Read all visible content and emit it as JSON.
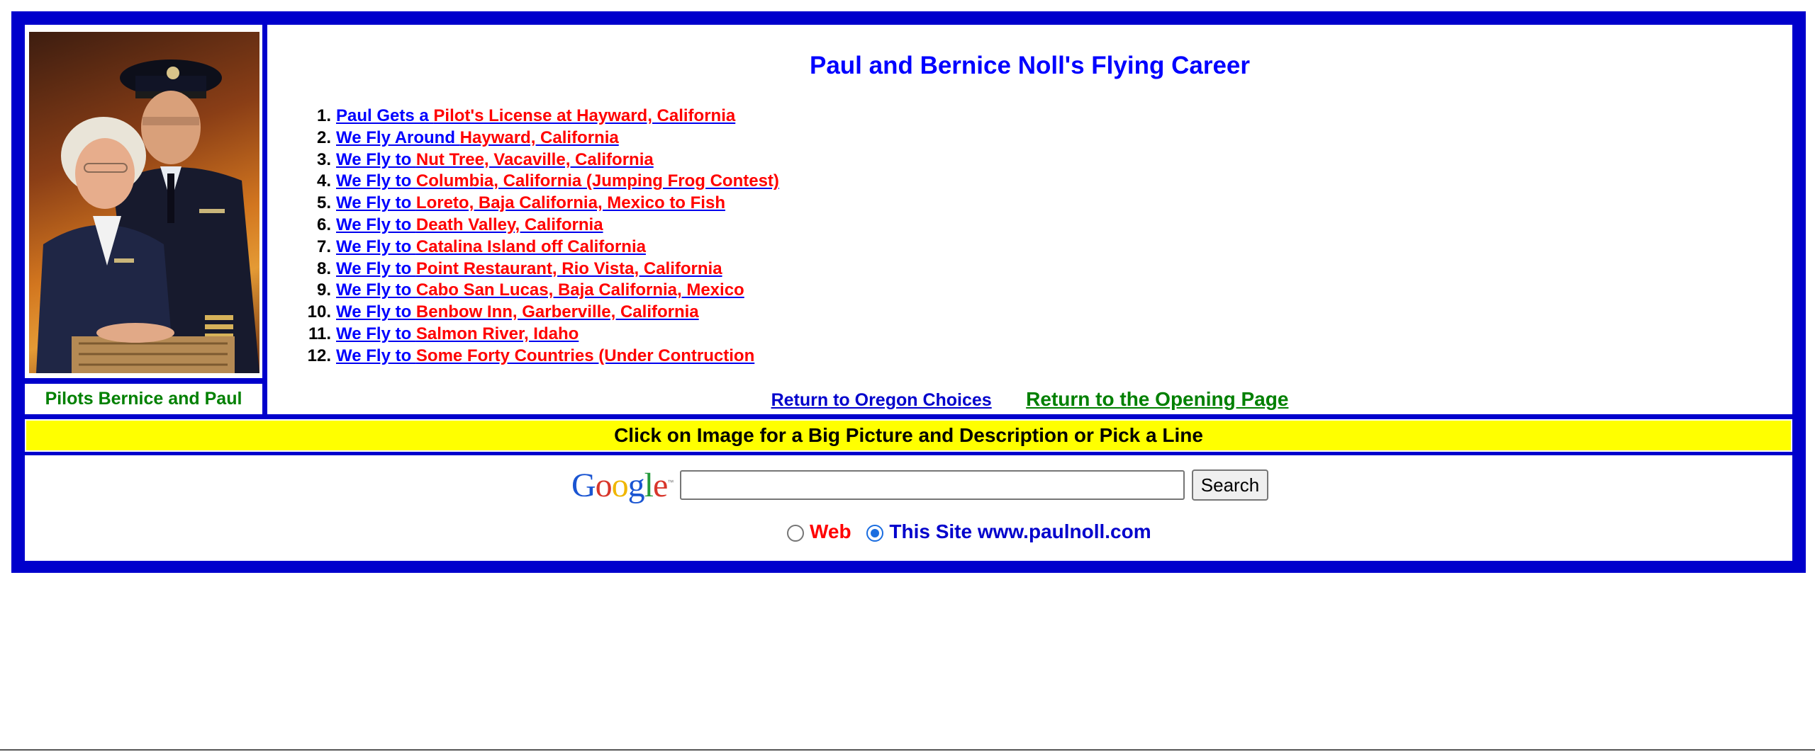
{
  "photo": {
    "caption": "Pilots Bernice and Paul",
    "alt": "Bernice and Paul in pilot uniforms"
  },
  "title": "Paul and Bernice Noll's Flying Career",
  "flights": [
    {
      "num": "1.",
      "lead": "Paul Gets a ",
      "dest": "Pilot's License at Hayward, California"
    },
    {
      "num": "2.",
      "lead": "We Fly Around ",
      "dest": "Hayward, California"
    },
    {
      "num": "3.",
      "lead": "We Fly to ",
      "dest": "Nut Tree, Vacaville, California"
    },
    {
      "num": "4.",
      "lead": "We Fly to ",
      "dest": "Columbia, California (Jumping Frog Contest)"
    },
    {
      "num": "5.",
      "lead": "We Fly to ",
      "dest": "Loreto, Baja California, Mexico to Fish"
    },
    {
      "num": "6.",
      "lead": "We Fly to ",
      "dest": "Death Valley, California"
    },
    {
      "num": "7.",
      "lead": "We Fly to ",
      "dest": "Catalina Island off California"
    },
    {
      "num": "8.",
      "lead": "We Fly to ",
      "dest": "Point Restaurant, Rio Vista, California"
    },
    {
      "num": "9.",
      "lead": "We Fly to ",
      "dest": "Cabo San Lucas, Baja California, Mexico"
    },
    {
      "num": "10.",
      "lead": "We Fly to ",
      "dest": "Benbow Inn, Garberville, California"
    },
    {
      "num": "11.",
      "lead": "We Fly to ",
      "dest": "Salmon River, Idaho"
    },
    {
      "num": "12.",
      "lead": "We Fly to ",
      "dest": "Some Forty Countries (Under Contruction"
    }
  ],
  "links": {
    "return_oregon": "Return to Oregon Choices",
    "return_opening": "Return to the Opening Page"
  },
  "instruction": "Click on Image for a Big Picture and Description or Pick a Line",
  "search": {
    "logo": "Google",
    "input_value": "",
    "button_label": "Search",
    "options": [
      {
        "label": "Web",
        "selected": false
      },
      {
        "label": "This Site www.paulnoll.com",
        "selected": true
      }
    ]
  },
  "colors": {
    "frame": "#0000cc",
    "link_blue": "#0000ff",
    "link_red": "#ff0000",
    "caption_green": "#008000",
    "bar_yellow": "#ffff00"
  }
}
